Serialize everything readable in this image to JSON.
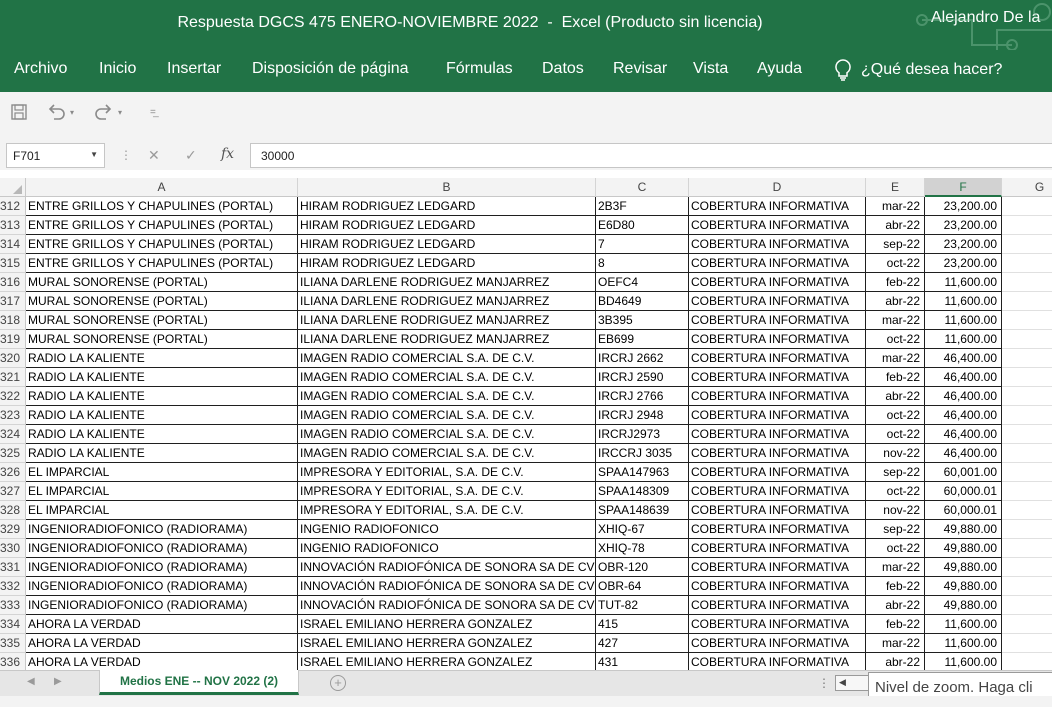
{
  "window": {
    "title": "Respuesta DGCS 475 ENERO-NOVIEMBRE 2022  -  Excel (Producto sin licencia)",
    "user": "Alejandro De la"
  },
  "ribbon": {
    "tabs": [
      "Archivo",
      "Inicio",
      "Insertar",
      "Disposición de página",
      "Fórmulas",
      "Datos",
      "Revisar",
      "Vista",
      "Ayuda"
    ],
    "tell_me": "¿Qué desea hacer?"
  },
  "formula_bar": {
    "name_box": "F701",
    "fx_label": "fx",
    "value": "30000"
  },
  "columns": [
    "A",
    "B",
    "C",
    "D",
    "E",
    "F",
    "G"
  ],
  "selected_column": "F",
  "rows": [
    {
      "n": "312",
      "a": "ENTRE GRILLOS Y CHAPULINES (PORTAL)",
      "b": "HIRAM RODRIGUEZ LEDGARD",
      "c": "2B3F",
      "d": "COBERTURA INFORMATIVA",
      "e": "mar-22",
      "f": "23,200.00"
    },
    {
      "n": "313",
      "a": "ENTRE GRILLOS Y CHAPULINES (PORTAL)",
      "b": "HIRAM RODRIGUEZ LEDGARD",
      "c": "E6D80",
      "d": "COBERTURA INFORMATIVA",
      "e": "abr-22",
      "f": "23,200.00"
    },
    {
      "n": "314",
      "a": "ENTRE GRILLOS Y CHAPULINES (PORTAL)",
      "b": "HIRAM RODRIGUEZ LEDGARD",
      "c": "7",
      "d": "COBERTURA INFORMATIVA",
      "e": "sep-22",
      "f": "23,200.00"
    },
    {
      "n": "315",
      "a": "ENTRE GRILLOS Y CHAPULINES (PORTAL)",
      "b": "HIRAM RODRIGUEZ LEDGARD",
      "c": "8",
      "d": "COBERTURA INFORMATIVA",
      "e": "oct-22",
      "f": "23,200.00"
    },
    {
      "n": "316",
      "a": "MURAL SONORENSE (PORTAL)",
      "b": "ILIANA DARLENE RODRIGUEZ MANJARREZ",
      "c": "OEFC4",
      "d": "COBERTURA INFORMATIVA",
      "e": "feb-22",
      "f": "11,600.00"
    },
    {
      "n": "317",
      "a": "MURAL SONORENSE (PORTAL)",
      "b": "ILIANA DARLENE RODRIGUEZ MANJARREZ",
      "c": "BD4649",
      "d": "COBERTURA INFORMATIVA",
      "e": "abr-22",
      "f": "11,600.00"
    },
    {
      "n": "318",
      "a": "MURAL SONORENSE (PORTAL)",
      "b": "ILIANA DARLENE RODRIGUEZ MANJARREZ",
      "c": "3B395",
      "d": "COBERTURA INFORMATIVA",
      "e": "mar-22",
      "f": "11,600.00"
    },
    {
      "n": "319",
      "a": "MURAL SONORENSE (PORTAL)",
      "b": "ILIANA DARLENE RODRIGUEZ MANJARREZ",
      "c": "EB699",
      "d": "COBERTURA INFORMATIVA",
      "e": "oct-22",
      "f": "11,600.00"
    },
    {
      "n": "320",
      "a": "RADIO LA KALIENTE",
      "b": "IMAGEN RADIO COMERCIAL S.A. DE C.V.",
      "c": "IRCRJ 2662",
      "d": "COBERTURA INFORMATIVA",
      "e": "mar-22",
      "f": "46,400.00"
    },
    {
      "n": "321",
      "a": "RADIO LA KALIENTE",
      "b": "IMAGEN RADIO COMERCIAL S.A. DE C.V.",
      "c": "IRCRJ 2590",
      "d": "COBERTURA INFORMATIVA",
      "e": "feb-22",
      "f": "46,400.00"
    },
    {
      "n": "322",
      "a": "RADIO LA KALIENTE",
      "b": "IMAGEN RADIO COMERCIAL S.A. DE C.V.",
      "c": "IRCRJ 2766",
      "d": "COBERTURA INFORMATIVA",
      "e": "abr-22",
      "f": "46,400.00"
    },
    {
      "n": "323",
      "a": "RADIO LA KALIENTE",
      "b": "IMAGEN RADIO COMERCIAL S.A. DE C.V.",
      "c": "IRCRJ 2948",
      "d": "COBERTURA INFORMATIVA",
      "e": "oct-22",
      "f": "46,400.00"
    },
    {
      "n": "324",
      "a": "RADIO LA KALIENTE",
      "b": "IMAGEN RADIO COMERCIAL S.A. DE C.V.",
      "c": "IRCRJ2973",
      "d": "COBERTURA INFORMATIVA",
      "e": "oct-22",
      "f": "46,400.00"
    },
    {
      "n": "325",
      "a": "RADIO LA KALIENTE",
      "b": "IMAGEN RADIO COMERCIAL S.A. DE C.V.",
      "c": "IRCCRJ 3035",
      "d": "COBERTURA INFORMATIVA",
      "e": "nov-22",
      "f": "46,400.00"
    },
    {
      "n": "326",
      "a": "EL IMPARCIAL",
      "b": "IMPRESORA Y EDITORIAL, S.A. DE C.V.",
      "c": "SPAA147963",
      "d": "COBERTURA INFORMATIVA",
      "e": "sep-22",
      "f": "60,001.00"
    },
    {
      "n": "327",
      "a": "EL IMPARCIAL",
      "b": "IMPRESORA Y EDITORIAL, S.A. DE C.V.",
      "c": "SPAA148309",
      "d": "COBERTURA INFORMATIVA",
      "e": "oct-22",
      "f": "60,000.01"
    },
    {
      "n": "328",
      "a": "EL IMPARCIAL",
      "b": "IMPRESORA Y EDITORIAL, S.A. DE C.V.",
      "c": "SPAA148639",
      "d": "COBERTURA INFORMATIVA",
      "e": "nov-22",
      "f": "60,000.01"
    },
    {
      "n": "329",
      "a": "INGENIORADIOFONICO (RADIORAMA)",
      "b": "INGENIO RADIOFONICO",
      "c": "XHIQ-67",
      "d": "COBERTURA INFORMATIVA",
      "e": "sep-22",
      "f": "49,880.00"
    },
    {
      "n": "330",
      "a": "INGENIORADIOFONICO (RADIORAMA)",
      "b": "INGENIO RADIOFONICO",
      "c": "XHIQ-78",
      "d": "COBERTURA INFORMATIVA",
      "e": "oct-22",
      "f": "49,880.00"
    },
    {
      "n": "331",
      "a": "INGENIORADIOFONICO (RADIORAMA)",
      "b": "INNOVACIÓN RADIOFÓNICA DE SONORA SA DE CV",
      "c": "OBR-120",
      "d": "COBERTURA INFORMATIVA",
      "e": "mar-22",
      "f": "49,880.00"
    },
    {
      "n": "332",
      "a": "INGENIORADIOFONICO (RADIORAMA)",
      "b": "INNOVACIÓN RADIOFÓNICA DE SONORA SA DE CV",
      "c": "OBR-64",
      "d": "COBERTURA INFORMATIVA",
      "e": "feb-22",
      "f": "49,880.00"
    },
    {
      "n": "333",
      "a": "INGENIORADIOFONICO (RADIORAMA)",
      "b": "INNOVACIÓN RADIOFÓNICA DE SONORA SA DE CV",
      "c": "TUT-82",
      "d": "COBERTURA INFORMATIVA",
      "e": "abr-22",
      "f": "49,880.00"
    },
    {
      "n": "334",
      "a": "AHORA LA VERDAD",
      "b": "ISRAEL EMILIANO HERRERA GONZALEZ",
      "c": "415",
      "d": "COBERTURA INFORMATIVA",
      "e": "feb-22",
      "f": "11,600.00"
    },
    {
      "n": "335",
      "a": "AHORA LA VERDAD",
      "b": "ISRAEL EMILIANO HERRERA GONZALEZ",
      "c": "427",
      "d": "COBERTURA INFORMATIVA",
      "e": "mar-22",
      "f": "11,600.00"
    },
    {
      "n": "336",
      "a": "AHORA LA VERDAD",
      "b": "ISRAEL EMILIANO HERRERA GONZALEZ",
      "c": "431",
      "d": "COBERTURA INFORMATIVA",
      "e": "abr-22",
      "f": "11,600.00"
    }
  ],
  "sheet_tab": "Medios ENE -- NOV 2022 (2)",
  "tooltip": "Nivel de zoom. Haga cli",
  "colors": {
    "excel_green": "#217346",
    "ribbon_bg": "#f3f3f3"
  },
  "icons": [
    "save-icon",
    "undo-icon",
    "redo-icon",
    "customize-qat-icon",
    "lightbulb-icon",
    "cancel-icon",
    "enter-icon",
    "fx-icon",
    "add-sheet-icon"
  ]
}
